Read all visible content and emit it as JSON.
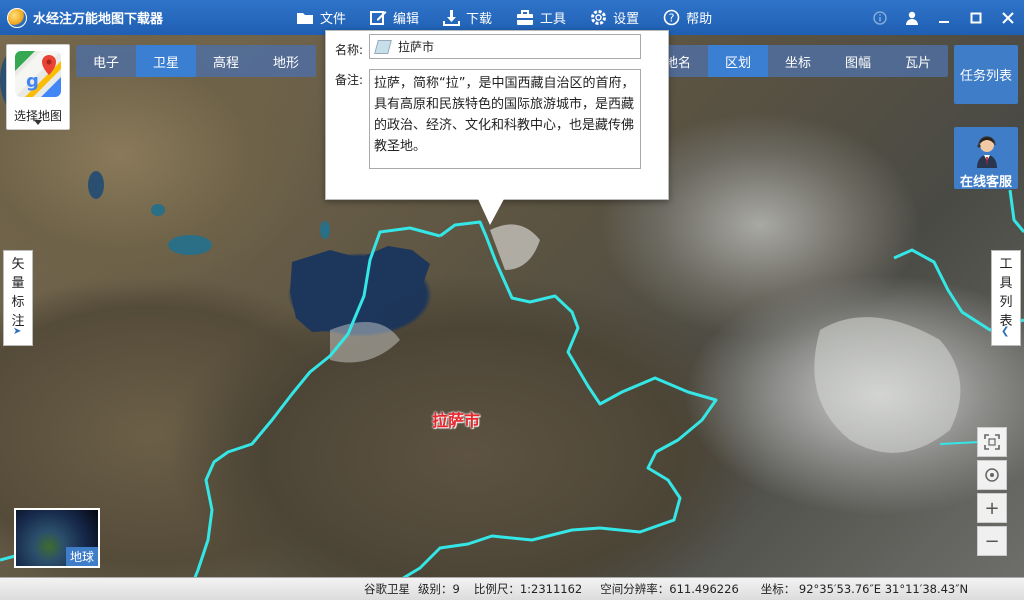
{
  "app": {
    "title": "水经注万能地图下载器"
  },
  "menu": [
    {
      "label": "文件",
      "icon": "folder-icon"
    },
    {
      "label": "编辑",
      "icon": "edit-icon"
    },
    {
      "label": "下载",
      "icon": "download-icon"
    },
    {
      "label": "工具",
      "icon": "toolbox-icon"
    },
    {
      "label": "设置",
      "icon": "gear-icon"
    },
    {
      "label": "帮助",
      "icon": "help-icon"
    }
  ],
  "map_type_tabs": [
    {
      "label": "电子",
      "active": false
    },
    {
      "label": "卫星",
      "active": true
    },
    {
      "label": "高程",
      "active": false
    },
    {
      "label": "地形",
      "active": false
    }
  ],
  "layer_tabs": [
    {
      "label": "地名",
      "active": false
    },
    {
      "label": "区划",
      "active": true
    },
    {
      "label": "坐标",
      "active": false
    },
    {
      "label": "图幅",
      "active": false
    },
    {
      "label": "瓦片",
      "active": false
    }
  ],
  "select_map": {
    "label": "选择地图"
  },
  "popup": {
    "name_label": "名称:",
    "name_value": "拉萨市",
    "note_label": "备注:",
    "note_value": "拉萨，简称“拉”，是中国西藏自治区的首府，具有高原和民族特色的国际旅游城市，是西藏的政治、经济、文化和科教中心，也是藏传佛教圣地。"
  },
  "map": {
    "city_label": "拉萨市",
    "boundary_color": "#35e6e6",
    "label_color": "#e8262b"
  },
  "task_list": {
    "label": "任务列表"
  },
  "online_support": {
    "label": "在线客服"
  },
  "vector_tab": {
    "label": "矢量标注"
  },
  "tools_tab": {
    "label": "工具列表"
  },
  "globe": {
    "label": "地球"
  },
  "status": {
    "source": "谷歌卫星",
    "level": "级别：9",
    "scale": "比例尺：1:2311162",
    "resolution": "空间分辨率：611.496226",
    "coordinates": "坐标： 92°35′53.76″E  31°11′38.43″N"
  },
  "colors": {
    "titlebar": "#2566bb",
    "accent": "#3f7dc8"
  }
}
